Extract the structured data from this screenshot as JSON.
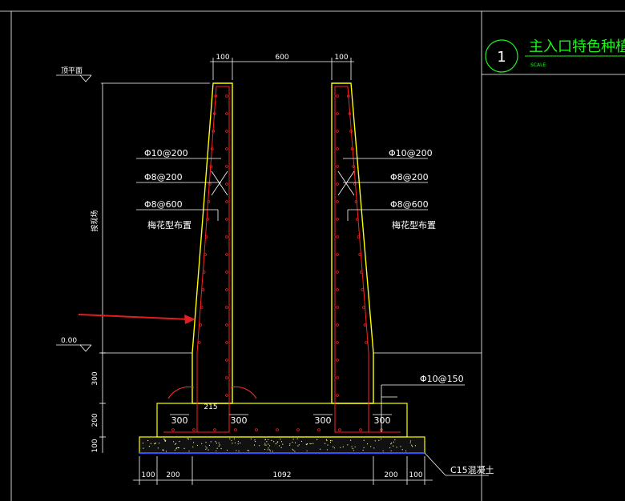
{
  "title": {
    "number": "1",
    "text": "主入口特色种植池",
    "scale_label": "SCALE"
  },
  "levels": {
    "top": "顶平面",
    "zero": "0.00"
  },
  "dimensions": {
    "top_left_wall": "100",
    "top_gap": "600",
    "top_right_wall": "100",
    "height_label": "按现场",
    "left_300_vertical": "300",
    "left_200_vertical": "200",
    "left_100_vertical": "100",
    "bottom_100_left": "100",
    "bottom_200_left": "200",
    "bottom_1092": "1092",
    "bottom_200_right": "200",
    "bottom_100_right": "100",
    "footing_300_a": "300",
    "footing_300_b": "300",
    "footing_300_c": "300",
    "footing_300_d": "300",
    "inner_dim": "215"
  },
  "rebar_notes_left": [
    "Φ10@200",
    "Φ8@200",
    "Φ8@600",
    "梅花型布置"
  ],
  "rebar_notes_right": [
    "Φ10@200",
    "Φ8@200",
    "Φ8@600",
    "梅花型布置"
  ],
  "footing_rebar": "Φ10@150",
  "base_note": "C15混凝土",
  "colors": {
    "wall_outline": "#ffff00",
    "rebar": "#ff2020",
    "dimension": "#ffffff",
    "title": "#22ee22",
    "background": "#000000",
    "arrow": "#e02020"
  }
}
